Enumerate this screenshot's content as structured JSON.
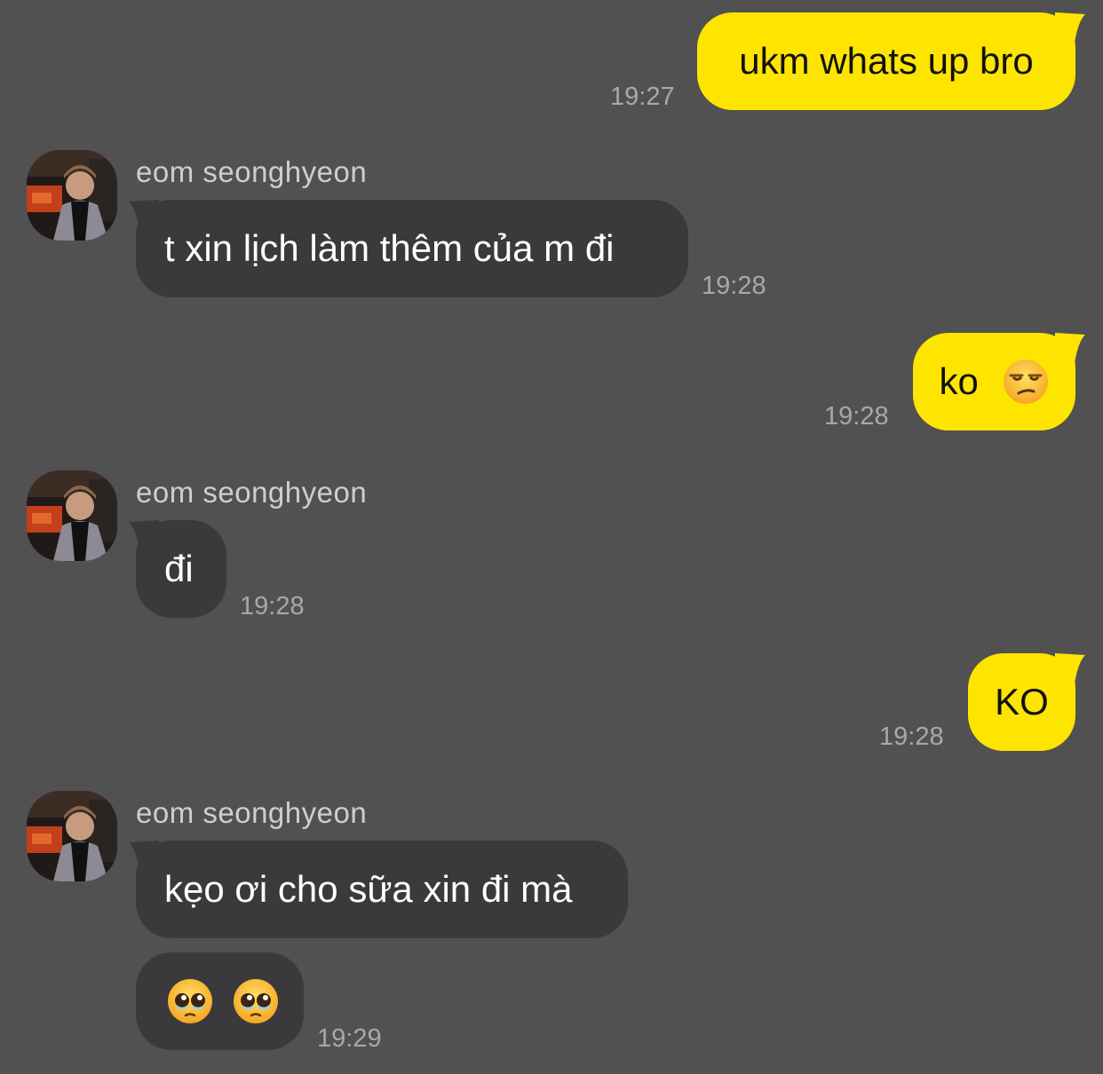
{
  "colors": {
    "background": "#525152",
    "outgoing_bubble": "#FEE500",
    "incoming_bubble": "#3A393B",
    "timestamp": "#A9A8A9",
    "sender_name": "#CFCECF"
  },
  "messages": [
    {
      "direction": "outgoing",
      "text": "ukm whats up bro",
      "time": "19:27"
    },
    {
      "direction": "incoming",
      "sender": "eom seonghyeon",
      "text": "t xin lịch làm thêm của m đi",
      "time": "19:28"
    },
    {
      "direction": "outgoing",
      "text": "ko",
      "emoji": "unamused-face-icon",
      "time": "19:28"
    },
    {
      "direction": "incoming",
      "sender": "eom seonghyeon",
      "text": "đi",
      "time": "19:28"
    },
    {
      "direction": "outgoing",
      "text": "KO",
      "time": "19:28"
    },
    {
      "direction": "incoming",
      "sender": "eom seonghyeon",
      "text": "kẹo ơi cho sữa xin đi mà"
    },
    {
      "direction": "incoming",
      "emoji": [
        "pleading-face-icon",
        "pleading-face-icon"
      ],
      "time": "19:29"
    }
  ]
}
